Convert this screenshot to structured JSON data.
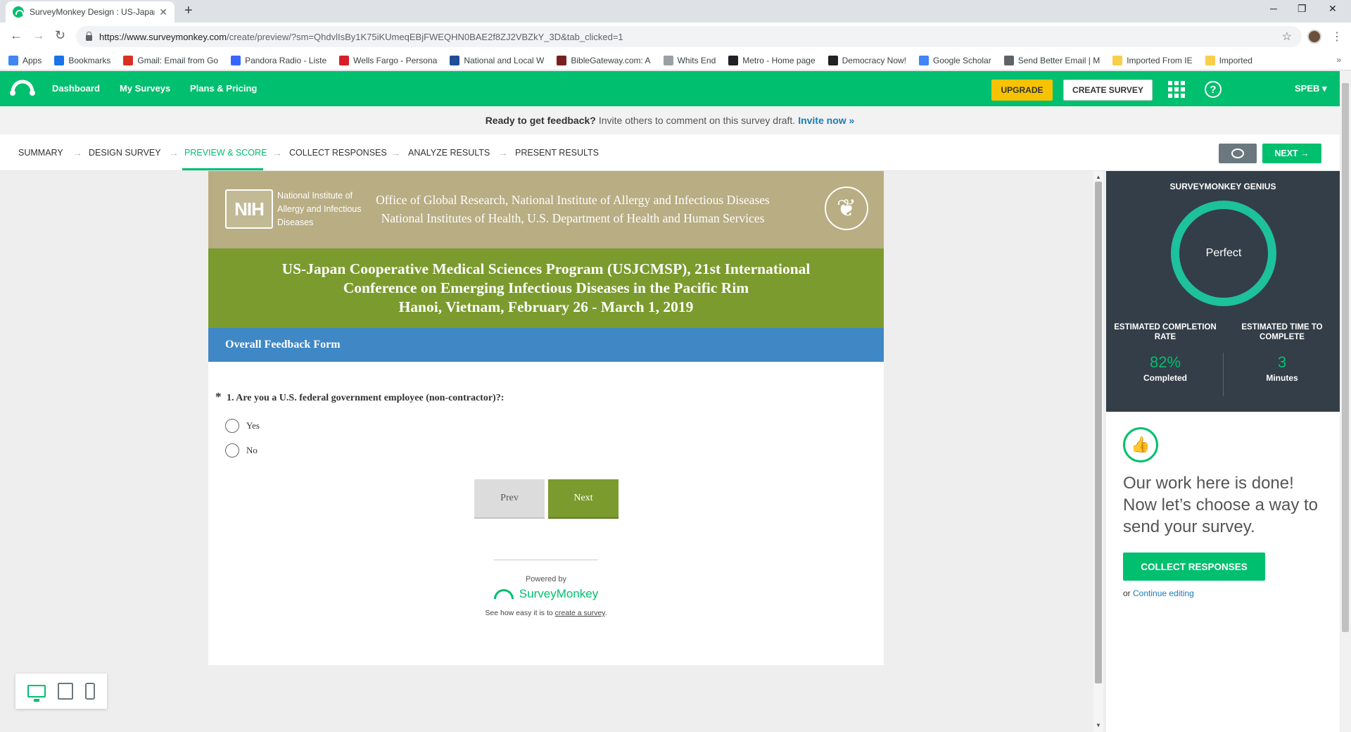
{
  "browser": {
    "tab_title": "SurveyMonkey Design : US-Japan",
    "tab_close": "✕",
    "new_tab": "+",
    "window_minimize": "─",
    "window_restore": "❐",
    "window_close": "✕",
    "url_host": "https://www.surveymonkey.com",
    "url_path": "/create/preview/?sm=QhdvlIsBy1K75iKUmeqEBjFWEQHN0BAE2f8ZJ2VBZkY_3D&tab_clicked=1",
    "bookmarks": [
      {
        "label": "Apps",
        "icon": "apps-grid-icon",
        "color": "#4285f4"
      },
      {
        "label": "Bookmarks",
        "icon": "star-icon",
        "color": "#1a73e8"
      },
      {
        "label": "Gmail: Email from Go",
        "icon": "gmail-icon",
        "color": "#d93025"
      },
      {
        "label": "Pandora Radio - Liste",
        "icon": "pandora-icon",
        "color": "#3668ff"
      },
      {
        "label": "Wells Fargo - Persona",
        "icon": "wellsfargo-icon",
        "color": "#d71e28"
      },
      {
        "label": "National and Local W",
        "icon": "weather-icon",
        "color": "#1f4e96"
      },
      {
        "label": "BibleGateway.com: A",
        "icon": "bible-icon",
        "color": "#7a1f1f"
      },
      {
        "label": "Whits End",
        "icon": "page-icon",
        "color": "#9aa0a6"
      },
      {
        "label": "Metro - Home page",
        "icon": "metro-icon",
        "color": "#202124"
      },
      {
        "label": "Democracy Now!",
        "icon": "democracy-icon",
        "color": "#202124"
      },
      {
        "label": "Google Scholar",
        "icon": "scholar-icon",
        "color": "#4285f4"
      },
      {
        "label": "Send Better Email | M",
        "icon": "email-icon",
        "color": "#5f6368"
      },
      {
        "label": "Imported From IE",
        "icon": "folder-icon",
        "color": "#f9ce4b"
      },
      {
        "label": "Imported",
        "icon": "folder-icon",
        "color": "#f9ce4b"
      }
    ],
    "bookmarks_more": "»"
  },
  "header": {
    "nav": [
      "Dashboard",
      "My Surveys",
      "Plans & Pricing"
    ],
    "upgrade": "UPGRADE",
    "create_survey": "CREATE SURVEY",
    "help": "?",
    "user": "SPEB ▾"
  },
  "invite_banner": {
    "bold": "Ready to get feedback?",
    "text": "Invite others to comment on this survey draft.",
    "link": "Invite now »"
  },
  "steps": {
    "items": [
      "SUMMARY",
      "DESIGN SURVEY",
      "PREVIEW & SCORE",
      "COLLECT RESPONSES",
      "ANALYZE RESULTS",
      "PRESENT RESULTS"
    ],
    "active_index": 2,
    "next": "NEXT →"
  },
  "survey": {
    "nih_logo": "NIH",
    "nih_name": "National Institute of Allergy and Infectious Diseases",
    "org_line1": "Office of Global Research, National Institute of Allergy and Infectious Diseases",
    "org_line2": "National Institutes of Health, U.S. Department of Health and Human Services",
    "title_line1": "US-Japan Cooperative Medical Sciences Program (USJCMSP), 21st International",
    "title_line2": "Conference on Emerging Infectious Diseases in the Pacific Rim",
    "title_line3": "Hanoi, Vietnam, February 26 - March 1, 2019",
    "form_name": "Overall Feedback Form",
    "required_mark": "*",
    "question": "1. Are you a U.S. federal government employee (non-contractor)?:",
    "options": [
      "Yes",
      "No"
    ],
    "prev": "Prev",
    "next": "Next",
    "powered_by": "Powered by",
    "brand": "SurveyMonkey",
    "see_how_prefix": "See how easy it is to",
    "see_how_link": "create a survey",
    "see_how_suffix": "."
  },
  "genius": {
    "title": "SURVEYMONKEY GENIUS",
    "score": "Perfect",
    "completion_label": "ESTIMATED COMPLETION RATE",
    "completion_value": "82%",
    "completion_unit": "Completed",
    "time_label": "ESTIMATED TIME TO COMPLETE",
    "time_value": "3",
    "time_unit": "Minutes"
  },
  "side": {
    "message": "Our work here is done! Now let’s choose a way to send your survey.",
    "collect": "COLLECT RESPONSES",
    "or": "or",
    "continue": "Continue editing"
  },
  "colors": {
    "brand_green": "#00bf6f",
    "upgrade_yellow": "#f7c200",
    "nih_tan": "#b8ad83",
    "title_olive": "#7b9b2e",
    "form_blue": "#3f88c5",
    "genius_dark": "#333e48"
  }
}
